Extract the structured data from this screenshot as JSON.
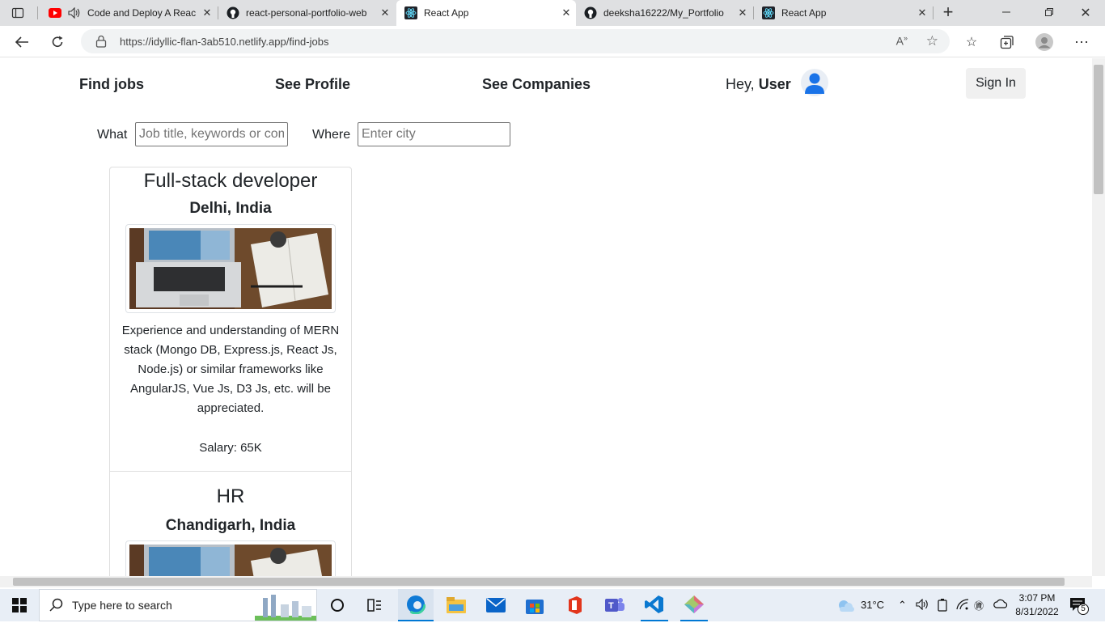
{
  "browser": {
    "tabs": [
      {
        "title": "Code and Deploy A Reac",
        "icon": "youtube-icon"
      },
      {
        "title": "react-personal-portfolio-web",
        "icon": "github-icon"
      },
      {
        "title": "React App",
        "icon": "react-icon",
        "active": true
      },
      {
        "title": "deeksha16222/My_Portfolio",
        "icon": "github-icon"
      },
      {
        "title": "React App",
        "icon": "react-icon"
      }
    ],
    "url": "https://idyllic-flan-3ab510.netlify.app/find-jobs"
  },
  "nav": {
    "find_jobs": "Find jobs",
    "see_profile": "See Profile",
    "see_companies": "See Companies",
    "greeting": "Hey,",
    "user": "User",
    "sign_in": "Sign In"
  },
  "search": {
    "what_label": "What",
    "what_placeholder": "Job title, keywords or company",
    "where_label": "Where",
    "where_placeholder": "Enter city"
  },
  "jobs": [
    {
      "title": "Full-stack developer",
      "location": "Delhi, India",
      "description": "Experience and understanding of MERN stack (Mongo DB, Express.js, React Js, Node.js) or similar frameworks like AngularJS, Vue Js, D3 Js, etc. will be appreciated.",
      "salary": "Salary: 65K"
    },
    {
      "title": "HR",
      "location": "Chandigarh, India"
    }
  ],
  "taskbar": {
    "search_placeholder": "Type here to search",
    "weather": "31°C",
    "time": "3:07 PM",
    "date": "8/31/2022",
    "notifications": "5"
  },
  "colors": {
    "accent": "#0078d4",
    "avatar": "#1a73e8"
  }
}
